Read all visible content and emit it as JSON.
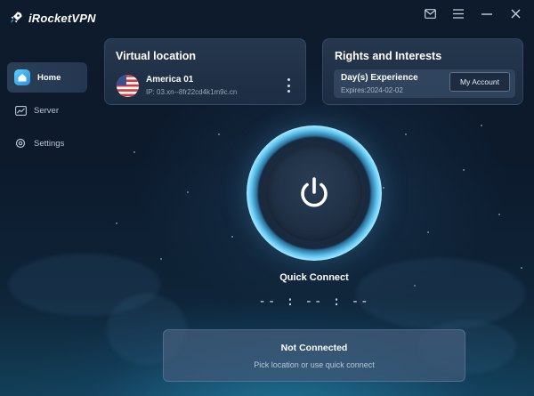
{
  "app": {
    "name": "iRocketVPN"
  },
  "window_controls": [
    {
      "name": "mail-icon"
    },
    {
      "name": "menu-icon"
    },
    {
      "name": "minimize-icon"
    },
    {
      "name": "close-icon"
    }
  ],
  "sidebar": {
    "items": [
      {
        "label": "Home",
        "icon": "home-icon",
        "active": true
      },
      {
        "label": "Server",
        "icon": "chart-icon",
        "active": false
      },
      {
        "label": "Settings",
        "icon": "gear-icon",
        "active": false
      }
    ]
  },
  "virtual_location": {
    "title": "Virtual location",
    "server_name": "America 01",
    "ip": "IP: 03.xn--8fr22cd4k1m9c.cn",
    "flag": "us-flag-icon"
  },
  "rights": {
    "title": "Rights and Interests",
    "plan": "Day(s) Experience",
    "expires": "Expires:2024-02-02",
    "account_button": "My Account"
  },
  "connect": {
    "label": "Quick Connect",
    "timer": "-- : -- : --",
    "button_icon": "power-icon"
  },
  "status": {
    "title": "Not Connected",
    "subtitle": "Pick location or use quick connect"
  },
  "colors": {
    "accent": "#5fc6f0",
    "background": "#0e1b2d",
    "card": "#283a52"
  }
}
